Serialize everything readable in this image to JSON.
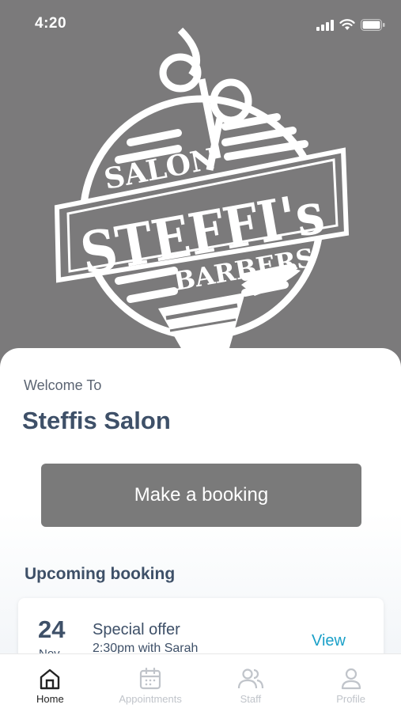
{
  "status_bar": {
    "time": "4:20"
  },
  "logo": {
    "top_text": "SALON",
    "banner_text": "STEFFI's",
    "bottom_text": "BARBERS"
  },
  "welcome_label": "Welcome To",
  "salon_name": "Steffis Salon",
  "booking_button_label": "Make a booking",
  "upcoming_title": "Upcoming booking",
  "booking": {
    "day": "24",
    "month": "Nov",
    "title": "Special offer",
    "subtitle": "2:30pm with Sarah",
    "view_label": "View"
  },
  "tabs": [
    {
      "label": "Home",
      "icon": "home-icon",
      "active": true
    },
    {
      "label": "Appointments",
      "icon": "calendar-icon",
      "active": false
    },
    {
      "label": "Staff",
      "icon": "people-icon",
      "active": false
    },
    {
      "label": "Profile",
      "icon": "person-icon",
      "active": false
    }
  ],
  "colors": {
    "header_bg": "#7b7a7b",
    "primary_text": "#3e5068",
    "button_bg": "#7a7a7a",
    "link": "#1aa0c8",
    "inactive_tab": "#c0c4ca"
  }
}
